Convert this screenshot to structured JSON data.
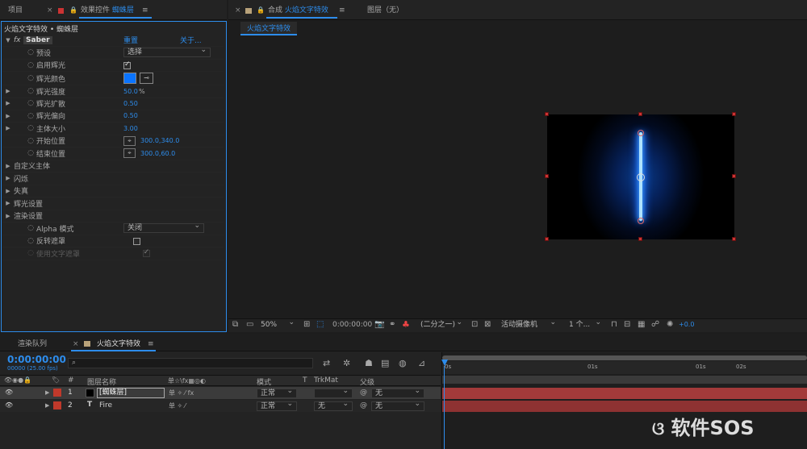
{
  "top_tabs": {
    "project": "项目",
    "effect_controls_prefix": "效果控件",
    "effect_controls_layer": "蜘蛛层",
    "comp_prefix": "合成",
    "comp_name": "火焰文字特效",
    "layer_panel": "图层（无）"
  },
  "effect_panel": {
    "breadcrumb": "火焰文字特效 • 蜘蛛层",
    "fx": "fx",
    "effect_name": "Saber",
    "reset": "重置",
    "about": "关于...",
    "rows": [
      {
        "label": "预设",
        "value": "选择"
      },
      {
        "label": "启用辉光"
      },
      {
        "label": "辉光颜色"
      },
      {
        "label": "辉光强度",
        "value": "50.0",
        "unit": "%"
      },
      {
        "label": "辉光扩散",
        "value": "0.50"
      },
      {
        "label": "辉光偏向",
        "value": "0.50"
      },
      {
        "label": "主体大小",
        "value": "3.00"
      },
      {
        "label": "开始位置",
        "value": "300.0,340.0"
      },
      {
        "label": "结束位置",
        "value": "300.0,60.0"
      },
      {
        "label": "自定义主体"
      },
      {
        "label": "闪烁"
      },
      {
        "label": "失真"
      },
      {
        "label": "辉光设置"
      },
      {
        "label": "渲染设置"
      },
      {
        "label": "Alpha 模式",
        "value": "关闭"
      },
      {
        "label": "反转遮罩"
      },
      {
        "label": "使用文字遮罩"
      }
    ],
    "glow_color": "#0a74ff"
  },
  "viewer": {
    "comp_tab": "火焰文字特效"
  },
  "viewer_toolbar": {
    "zoom": "50%",
    "timecode": "0:00:00:00",
    "resolution": "(二分之一)",
    "camera": "活动摄像机",
    "views": "1 个...",
    "exposure": "+0.0"
  },
  "bottom_tabs": {
    "render_queue": "渲染队列",
    "comp": "火焰文字特效"
  },
  "timeline": {
    "timecode": "0:00:00:00",
    "frame_info": "00000 (25.00 fps)",
    "search_placeholder": "",
    "headers": {
      "num": "#",
      "layer_name": "图层名称",
      "switches": "单☆\\fx▦◎◐",
      "mode": "模式",
      "t": "T",
      "trkmat": "TrkMat",
      "parent": "父级"
    },
    "ruler": [
      "0s",
      "01s",
      "01s",
      "02s"
    ],
    "layers": [
      {
        "num": "1",
        "name": "[蜘蛛层]",
        "mode": "正常",
        "trkmat": "",
        "parent": "无",
        "color": "#c0392b"
      },
      {
        "num": "2",
        "name": "Fire",
        "mode": "正常",
        "trkmat": "无",
        "parent": "无",
        "color": "#c0392b"
      }
    ]
  },
  "watermark": "软件SOS"
}
